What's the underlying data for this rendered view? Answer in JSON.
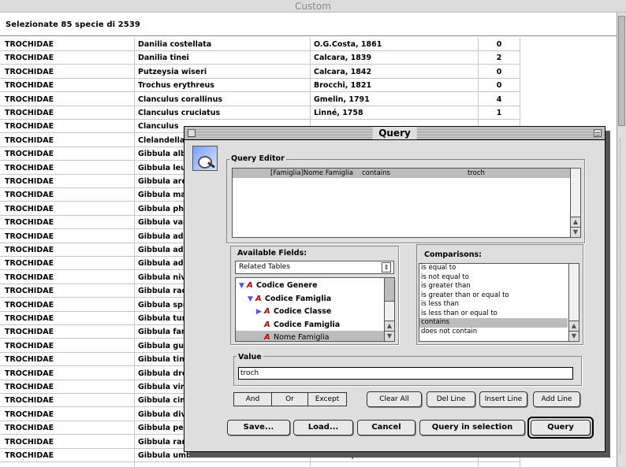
{
  "window": {
    "title": "Custom"
  },
  "selection_text": "Selezionate 85 specie di 2539",
  "rows": [
    [
      "TROCHIDAE",
      "Danilia costellata",
      "O.G.Costa, 1861",
      "0"
    ],
    [
      "TROCHIDAE",
      "Danilia tinei",
      "Calcara, 1839",
      "2"
    ],
    [
      "TROCHIDAE",
      "Putzeysia wiseri",
      "Calcara, 1842",
      "0"
    ],
    [
      "TROCHIDAE",
      "Trochus erythreus",
      "Brocchi, 1821",
      "0"
    ],
    [
      "TROCHIDAE",
      "Clanculus corallinus",
      "Gmelin, 1791",
      "4"
    ],
    [
      "TROCHIDAE",
      "Clanculus cruciatus",
      "Linné, 1758",
      "1"
    ],
    [
      "TROCHIDAE",
      "Clanculus",
      "",
      ""
    ],
    [
      "TROCHIDAE",
      "Clelandella",
      "",
      ""
    ],
    [
      "TROCHIDAE",
      "Gibbula alb",
      "",
      ""
    ],
    [
      "TROCHIDAE",
      "Gibbula leu",
      "",
      ""
    ],
    [
      "TROCHIDAE",
      "Gibbula ard",
      "",
      ""
    ],
    [
      "TROCHIDAE",
      "Gibbula ma",
      "",
      ""
    ],
    [
      "TROCHIDAE",
      "Gibbula phi",
      "",
      ""
    ],
    [
      "TROCHIDAE",
      "Gibbula var",
      "",
      ""
    ],
    [
      "TROCHIDAE",
      "Gibbula ada",
      "",
      ""
    ],
    [
      "TROCHIDAE",
      "Gibbula ada",
      "",
      ""
    ],
    [
      "TROCHIDAE",
      "Gibbula adr",
      "",
      ""
    ],
    [
      "TROCHIDAE",
      "Gibbula niv",
      "",
      ""
    ],
    [
      "TROCHIDAE",
      "Gibbula rac",
      "",
      ""
    ],
    [
      "TROCHIDAE",
      "Gibbula spr",
      "",
      ""
    ],
    [
      "TROCHIDAE",
      "Gibbula tur",
      "",
      ""
    ],
    [
      "TROCHIDAE",
      "Gibbula fan",
      "",
      ""
    ],
    [
      "TROCHIDAE",
      "Gibbula gut",
      "",
      ""
    ],
    [
      "TROCHIDAE",
      "Gibbula tin",
      "",
      ""
    ],
    [
      "TROCHIDAE",
      "Gibbula dre",
      "",
      ""
    ],
    [
      "TROCHIDAE",
      "Gibbula vin",
      "",
      ""
    ],
    [
      "TROCHIDAE",
      "Gibbula cin",
      "",
      ""
    ],
    [
      "TROCHIDAE",
      "Gibbula div",
      "",
      ""
    ],
    [
      "TROCHIDAE",
      "Gibbula per",
      "",
      ""
    ],
    [
      "TROCHIDAE",
      "Gibbula rar",
      "",
      ""
    ],
    [
      "TROCHIDAE",
      "Gibbula umbilicalis",
      "Da Costa, 1778",
      "0"
    ]
  ],
  "dialog": {
    "title": "Query",
    "query_editor_label": "Query Editor",
    "query_line": {
      "field": "[Famiglia]Nome Famiglia",
      "op": "contains",
      "value": "troch"
    },
    "available_fields_label": "Available Fields:",
    "related_tables": "Related Tables",
    "tree": [
      {
        "label": "Codice Genere",
        "indent": 0,
        "tri": "down"
      },
      {
        "label": "Codice Famiglia",
        "indent": 1,
        "tri": "down"
      },
      {
        "label": "Codice Classe",
        "indent": 2,
        "tri": "right"
      },
      {
        "label": "Codice Famiglia",
        "indent": 2,
        "tri": ""
      },
      {
        "label": "Nome Famiglia",
        "indent": 2,
        "tri": ""
      }
    ],
    "comparisons_label": "Comparisons:",
    "comparisons": [
      "is equal to",
      "is not equal to",
      "is greater than",
      "is greater than or equal to",
      "is less than",
      "is less than or equal to",
      "contains",
      "does not contain"
    ],
    "selected_comparison": "contains",
    "value_label": "Value",
    "value_text": "troch",
    "buttons": {
      "and": "And",
      "or": "Or",
      "except": "Except",
      "clear_all": "Clear All",
      "del_line": "Del Line",
      "insert_line": "Insert Line",
      "add_line": "Add Line",
      "save": "Save...",
      "load": "Load...",
      "cancel": "Cancel",
      "query_in_selection": "Query in selection",
      "query": "Query"
    }
  }
}
